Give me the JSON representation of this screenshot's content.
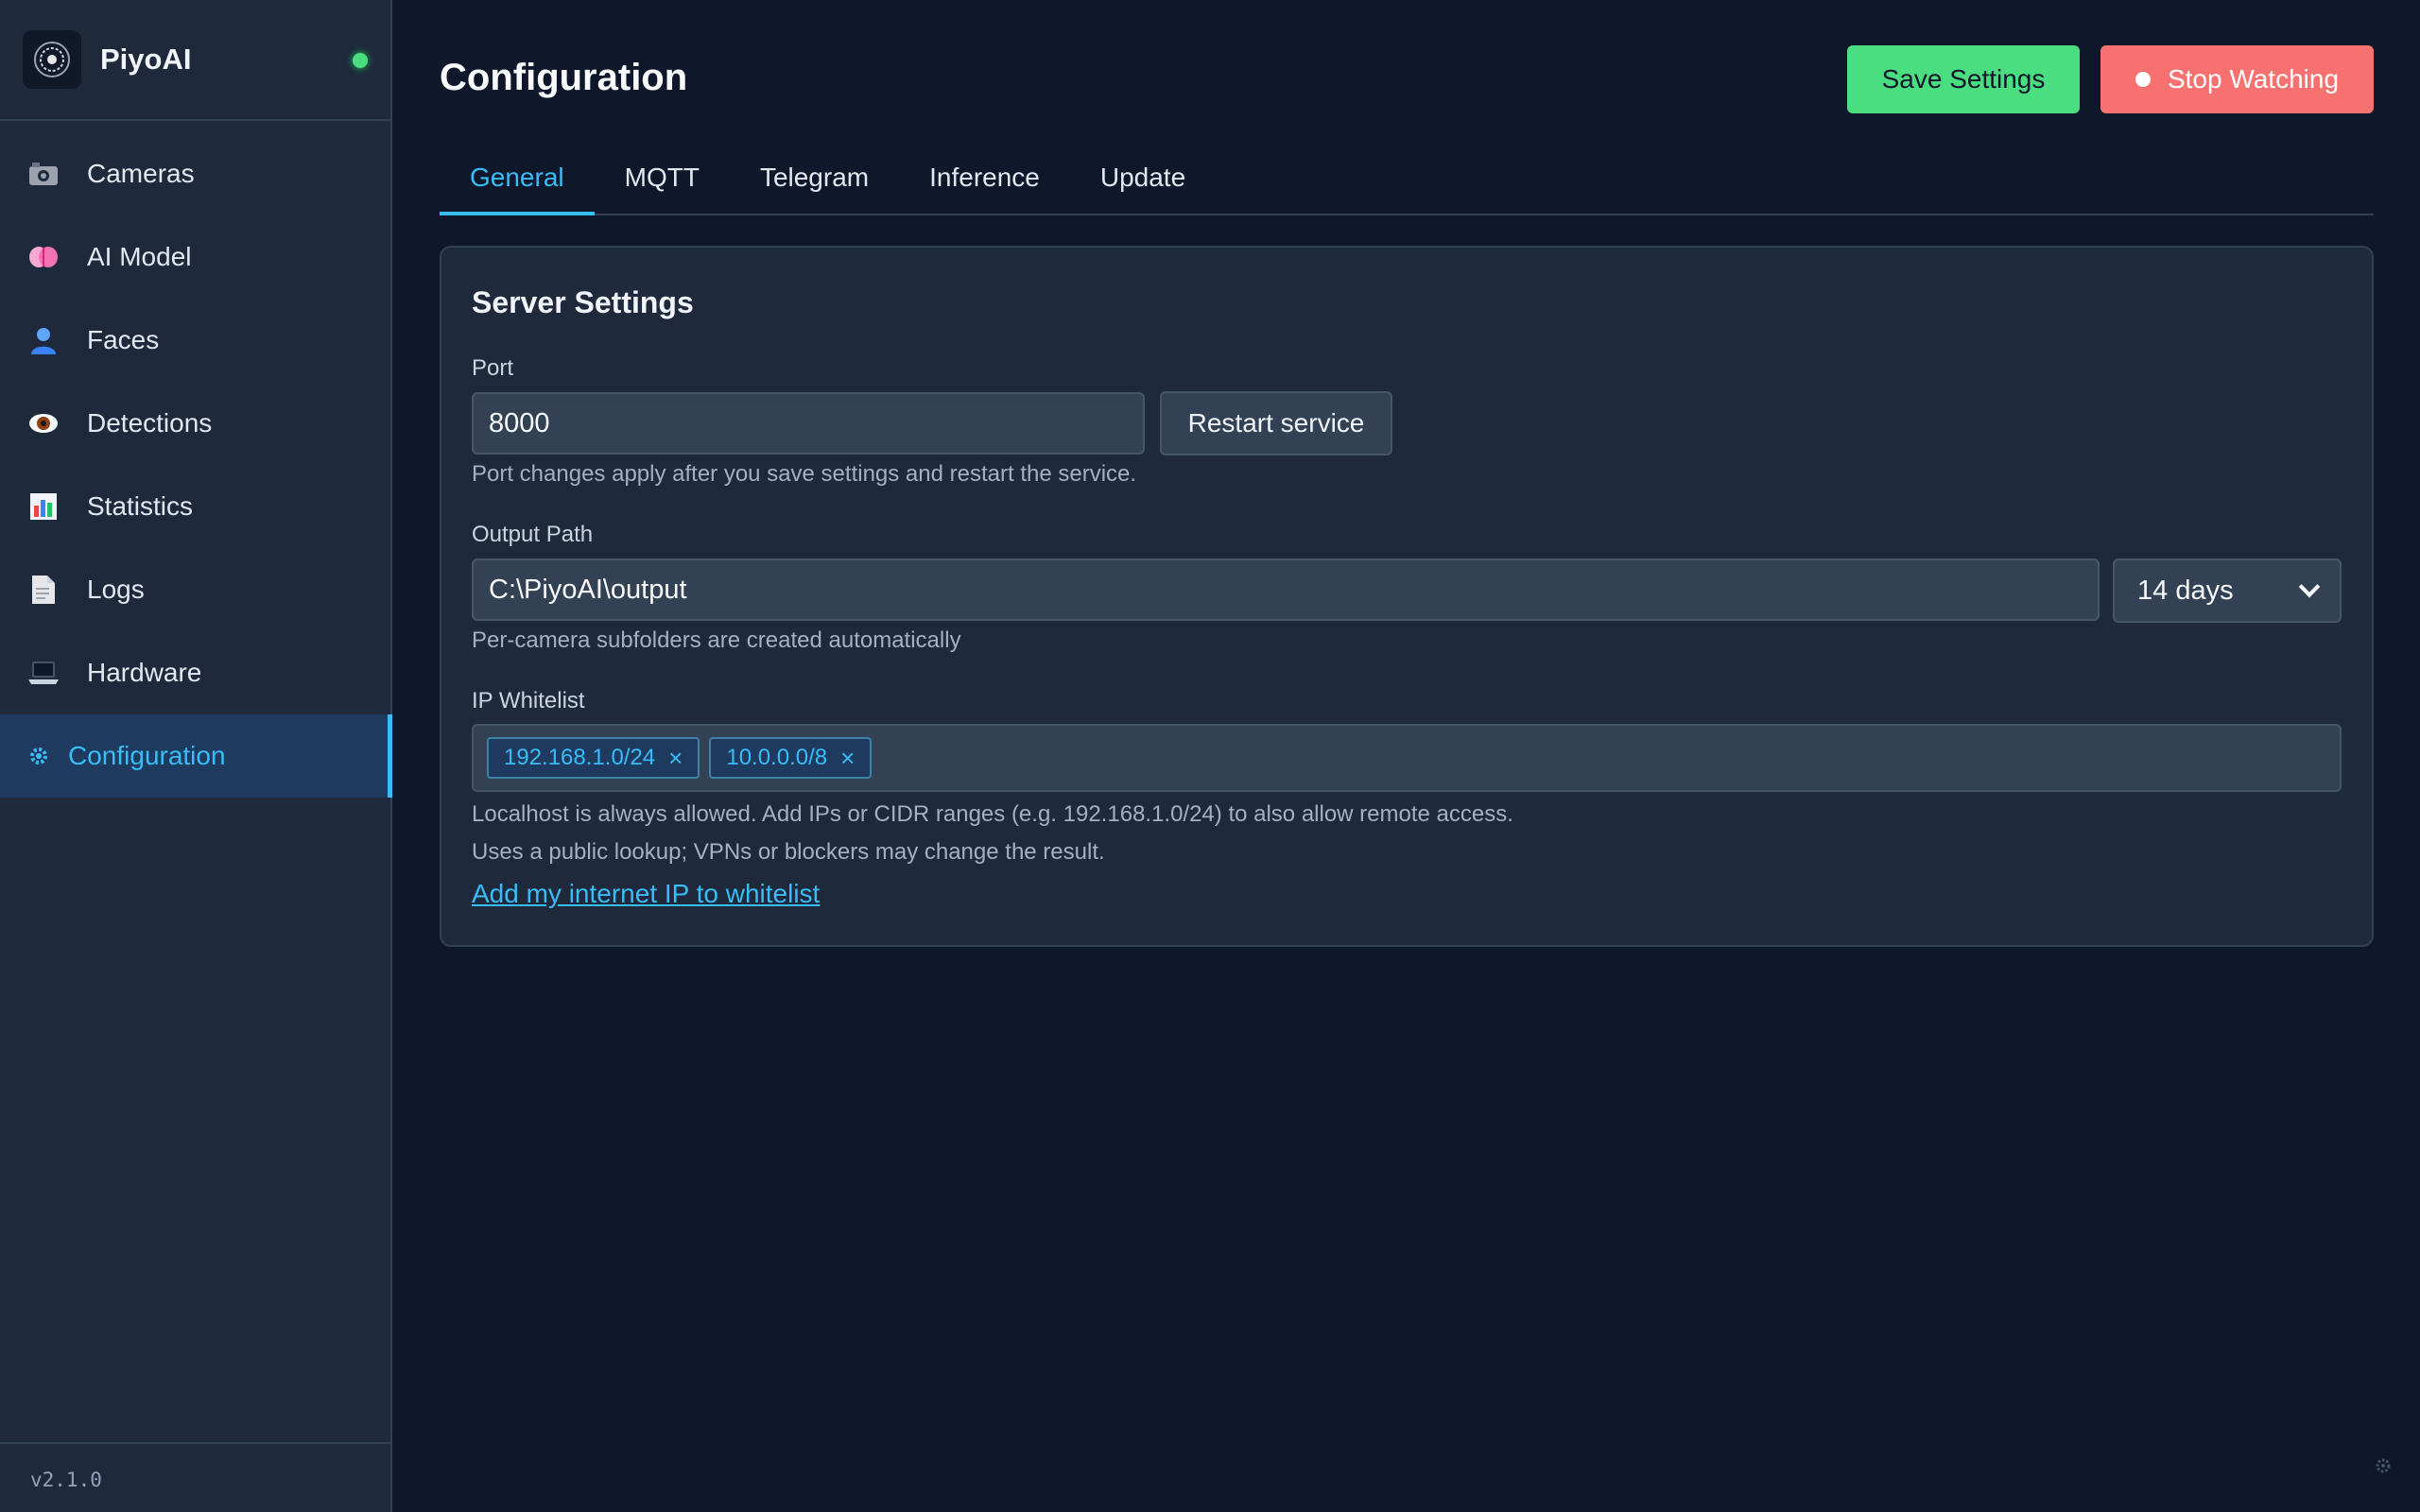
{
  "app": {
    "name": "PiyoAI",
    "version": "v2.1.0",
    "status_color": "#4ade80"
  },
  "sidebar": {
    "items": [
      {
        "label": "Cameras",
        "icon": "camera-icon"
      },
      {
        "label": "AI Model",
        "icon": "brain-icon"
      },
      {
        "label": "Faces",
        "icon": "person-icon"
      },
      {
        "label": "Detections",
        "icon": "eye-icon"
      },
      {
        "label": "Statistics",
        "icon": "bar-chart-icon"
      },
      {
        "label": "Logs",
        "icon": "document-icon"
      },
      {
        "label": "Hardware",
        "icon": "laptop-icon"
      },
      {
        "label": "Configuration",
        "icon": "gear-icon",
        "active": true
      }
    ]
  },
  "header": {
    "title": "Configuration",
    "save_label": "Save Settings",
    "stop_label": "Stop Watching"
  },
  "tabs": [
    {
      "label": "General",
      "active": true
    },
    {
      "label": "MQTT"
    },
    {
      "label": "Telegram"
    },
    {
      "label": "Inference"
    },
    {
      "label": "Update"
    }
  ],
  "server_settings": {
    "title": "Server Settings",
    "port": {
      "label": "Port",
      "value": "8000",
      "restart_label": "Restart service",
      "help": "Port changes apply after you save settings and restart the service."
    },
    "output_path": {
      "label": "Output Path",
      "value": "C:\\PiyoAI\\output",
      "retention": "14 days",
      "help": "Per-camera subfolders are created automatically"
    },
    "ip_whitelist": {
      "label": "IP Whitelist",
      "tags": [
        "192.168.1.0/24",
        "10.0.0.0/8"
      ],
      "help1": "Localhost is always allowed. Add IPs or CIDR ranges (e.g. 192.168.1.0/24) to also allow remote access.",
      "help2": "Uses a public lookup; VPNs or blockers may change the result.",
      "add_link": "Add my internet IP to whitelist"
    }
  },
  "colors": {
    "accent": "#38bdf8",
    "save": "#4ade80",
    "stop": "#f87171",
    "background": "#0f172a",
    "panel": "#1e293b"
  }
}
